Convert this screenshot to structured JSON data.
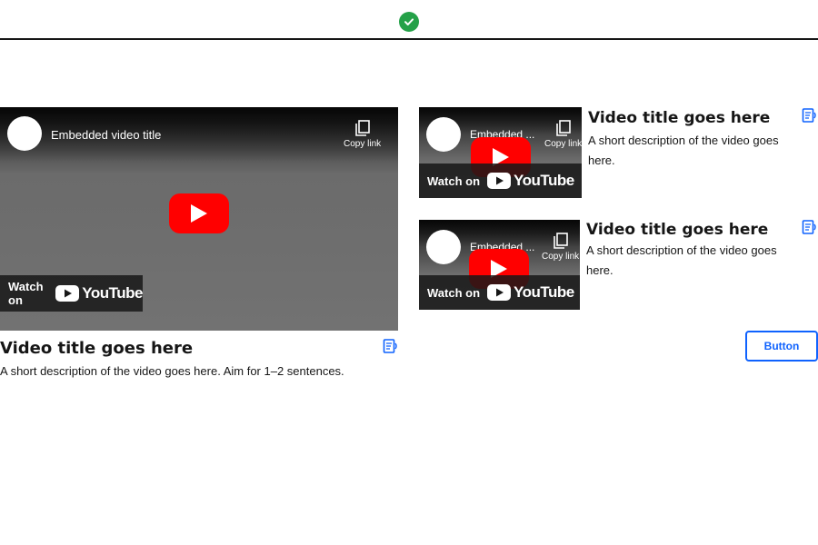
{
  "header": {
    "status_icon": "check-circle-icon",
    "status_color": "#24a148"
  },
  "main_video": {
    "embed_title": "Embedded video title",
    "copy_link_label": "Copy link",
    "watch_on_label": "Watch on",
    "youtube_label": "YouTube",
    "title": "Video title goes here",
    "description": "A short description of the video goes here. Aim for 1–2 sentences."
  },
  "side_videos": [
    {
      "embed_title": "Embedded ...",
      "copy_link_label": "Copy link",
      "watch_on_label": "Watch on",
      "youtube_label": "YouTube",
      "title": "Video title goes here",
      "description": "A short description of the video goes here."
    },
    {
      "embed_title": "Embedded ...",
      "copy_link_label": "Copy link",
      "watch_on_label": "Watch on",
      "youtube_label": "YouTube",
      "title": "Video title goes here",
      "description": "A short description of the video goes here."
    }
  ],
  "action_button": {
    "label": "Button"
  },
  "colors": {
    "accent": "#0f62fe",
    "youtube_red": "#ff0000",
    "success": "#24a148"
  }
}
